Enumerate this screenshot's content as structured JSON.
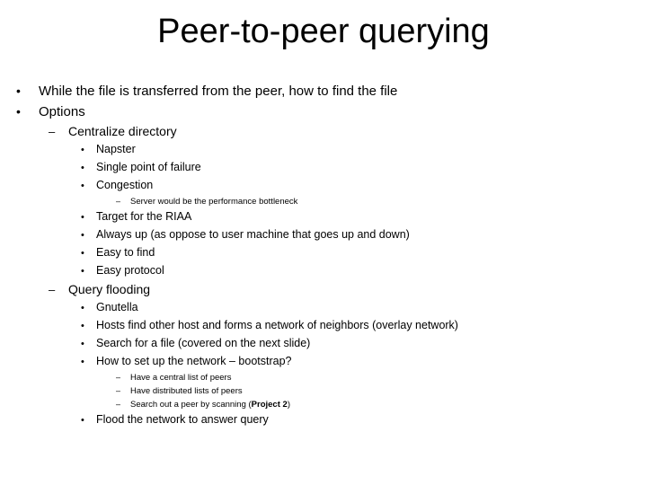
{
  "slide": {
    "title": "Peer-to-peer querying",
    "background_color": "#ffffff",
    "text_color": "#000000",
    "bullets": [
      {
        "level": 1,
        "marker": "•",
        "text": "While the file is transferred from the peer, how to find the file"
      },
      {
        "level": 1,
        "marker": "•",
        "text": "Options"
      },
      {
        "level": 2,
        "marker": "–",
        "text": "Centralize directory"
      },
      {
        "level": 3,
        "marker": "•",
        "text": "Napster"
      },
      {
        "level": 3,
        "marker": "•",
        "text": "Single point of failure"
      },
      {
        "level": 3,
        "marker": "•",
        "text": "Congestion"
      },
      {
        "level": 4,
        "marker": "–",
        "text": "Server would be the performance bottleneck"
      },
      {
        "level": 3,
        "marker": "•",
        "text": "Target for the RIAA"
      },
      {
        "level": 3,
        "marker": "•",
        "text": "Always up (as oppose to user machine that goes up and down)"
      },
      {
        "level": 3,
        "marker": "•",
        "text": "Easy to find"
      },
      {
        "level": 3,
        "marker": "•",
        "text": "Easy protocol"
      },
      {
        "level": 2,
        "marker": "–",
        "text": "Query flooding"
      },
      {
        "level": 3,
        "marker": "•",
        "text": "Gnutella"
      },
      {
        "level": 3,
        "marker": "•",
        "text": "Hosts find other host and forms a network of neighbors (overlay network)"
      },
      {
        "level": 3,
        "marker": "•",
        "text": "Search for a file (covered on the next slide)"
      },
      {
        "level": 3,
        "marker": "•",
        "text": "How to set up the network – bootstrap?"
      },
      {
        "level": 4,
        "marker": "–",
        "text": "Have a central list of peers"
      },
      {
        "level": 4,
        "marker": "–",
        "text": "Have distributed lists of peers"
      },
      {
        "level": 4,
        "marker": "–",
        "text_before": "Search out a peer by scanning  (",
        "text_bold": "Project 2",
        "text_after": ")"
      },
      {
        "level": 3,
        "marker": "•",
        "text": "Flood the network to answer query"
      }
    ]
  }
}
